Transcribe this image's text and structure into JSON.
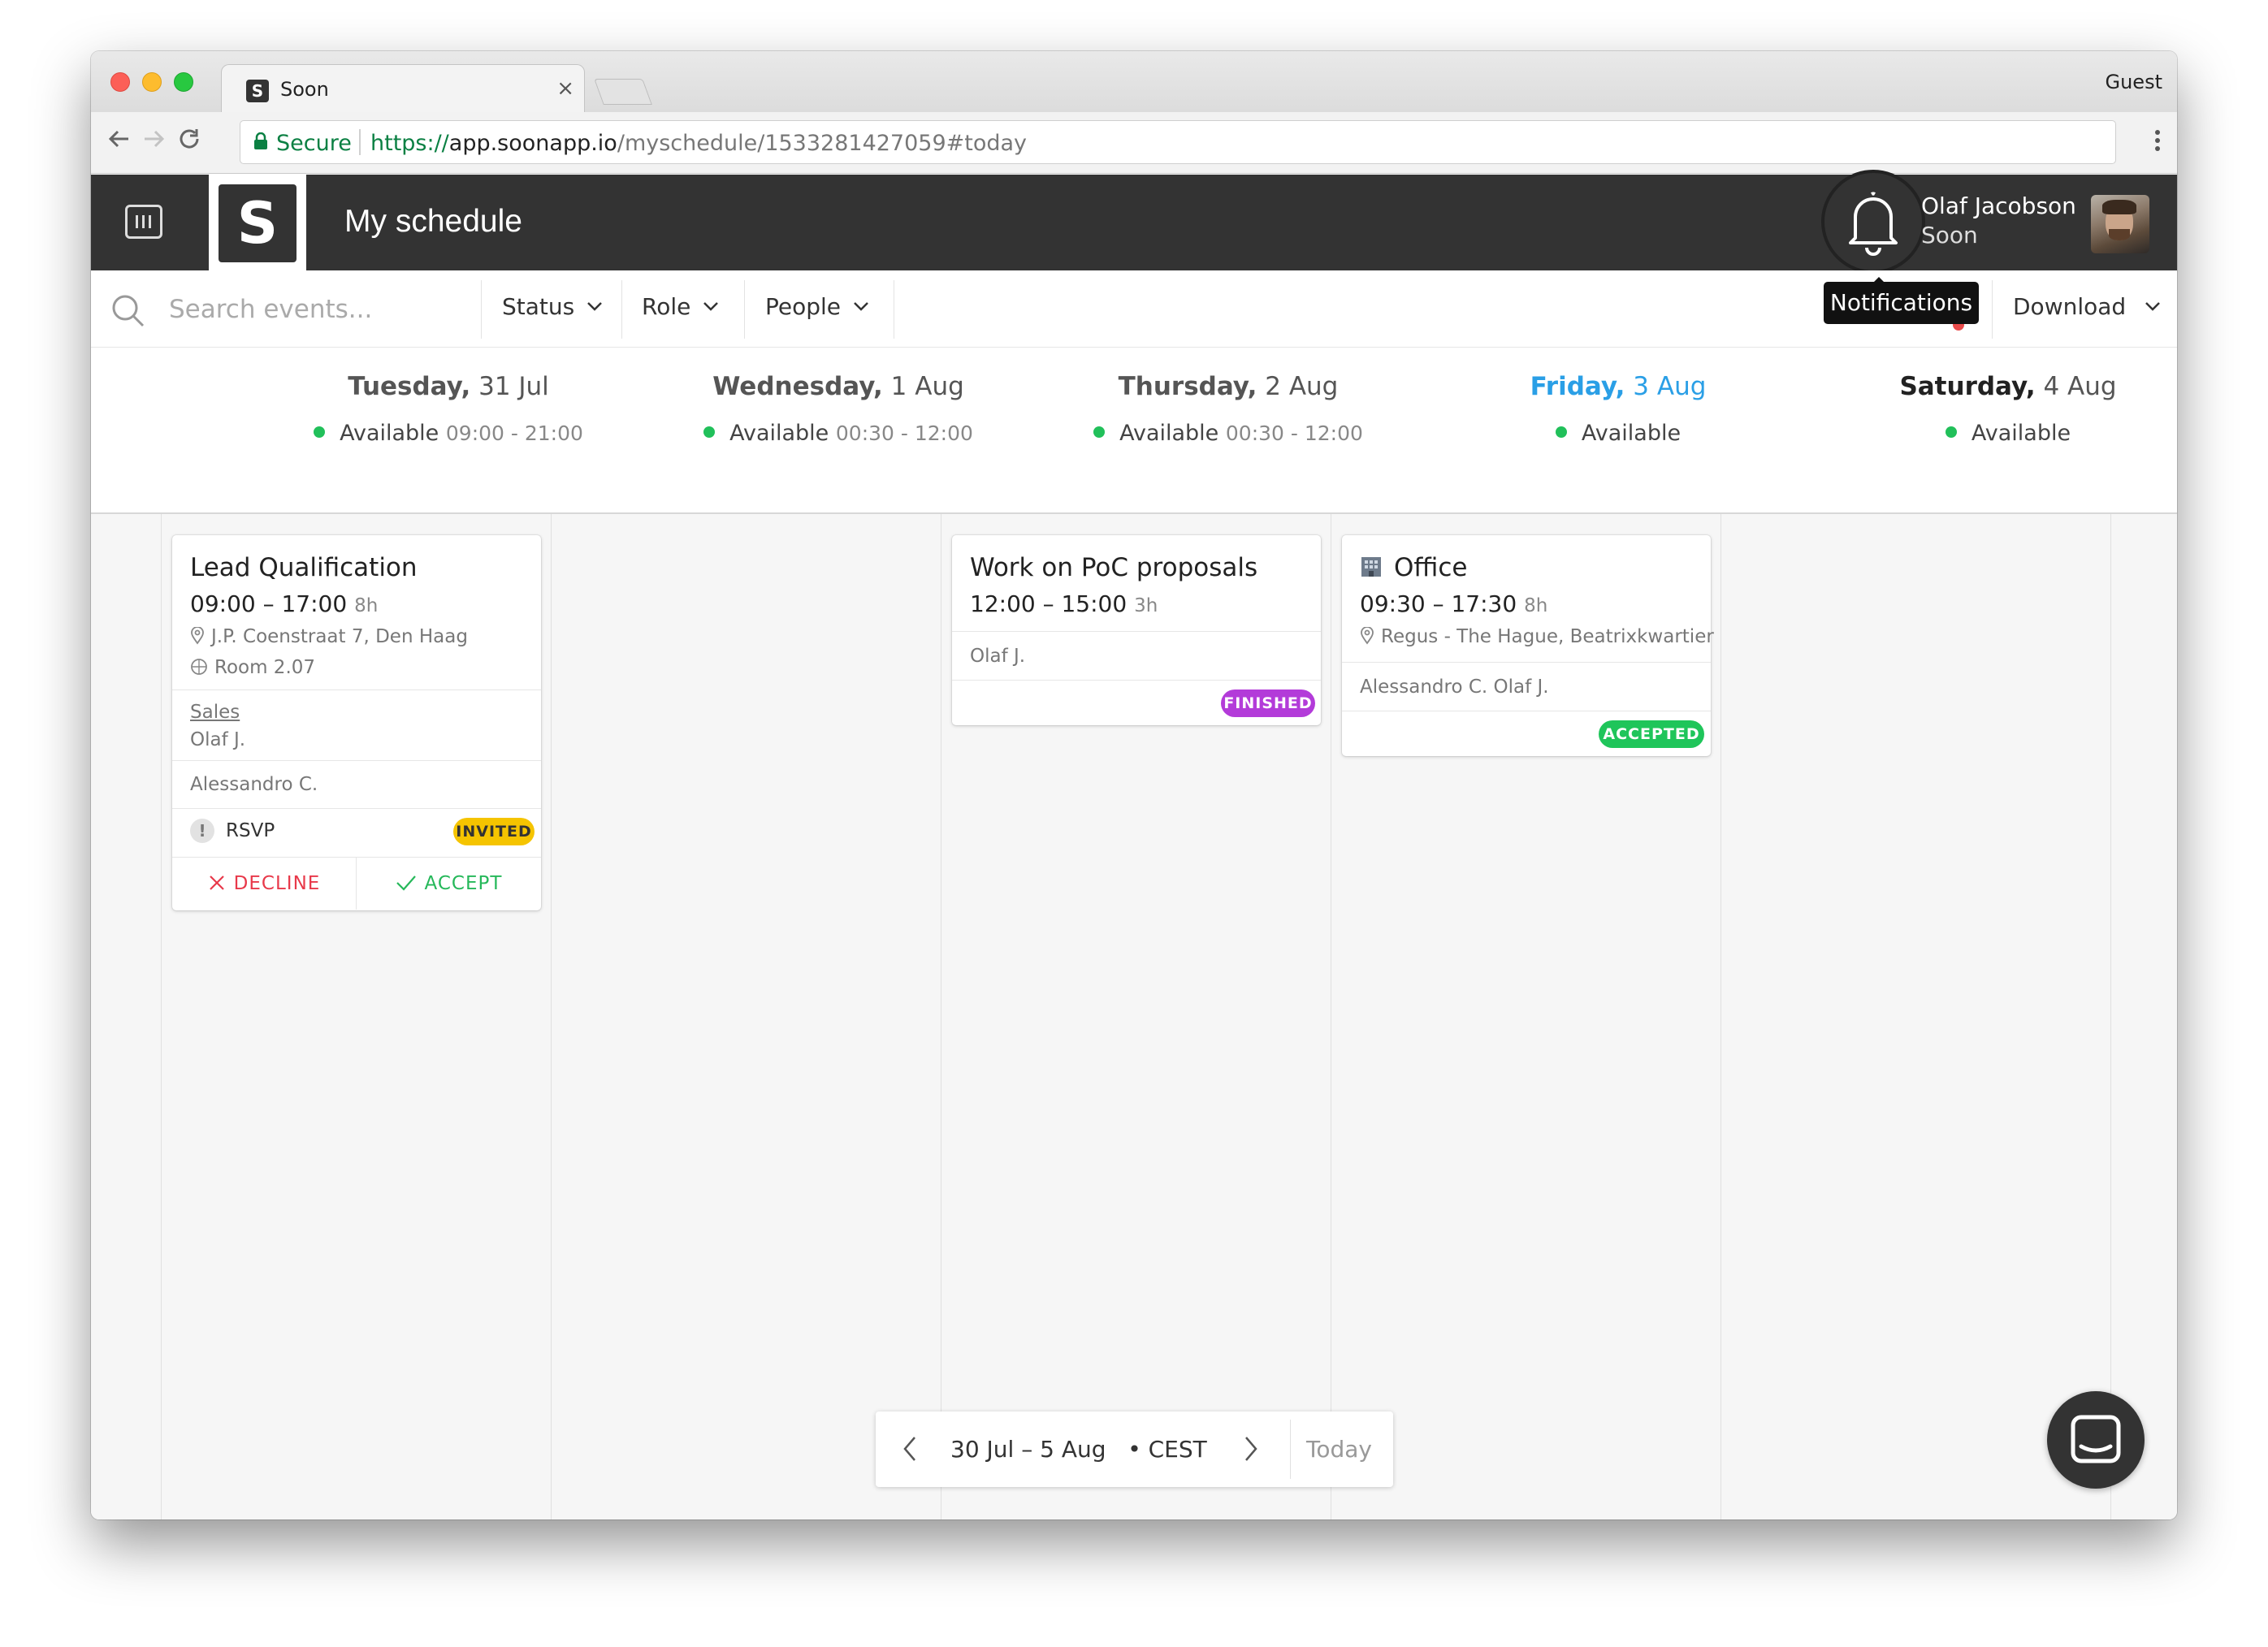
{
  "browser": {
    "tab_title": "Soon",
    "tab_favicon": "S",
    "tab_close": "×",
    "guest_label": "Guest",
    "secure_label": "Secure",
    "url_scheme": "https://",
    "url_host": "app.soonapp.io",
    "url_path": "/myschedule/1533281427059#today"
  },
  "header": {
    "logo": "S",
    "title": "My schedule",
    "user_name": "Olaf Jacobson",
    "user_org": "Soon",
    "notifications_tooltip": "Notifications"
  },
  "filters": {
    "search_placeholder": "Search events...",
    "status_label": "Status",
    "role_label": "Role",
    "people_label": "People",
    "download_label": "Download"
  },
  "days": [
    {
      "weekday": "Tuesday,",
      "date": "31 Jul",
      "availability": "Available",
      "hours": "09:00 - 21:00"
    },
    {
      "weekday": "Wednesday,",
      "date": "1 Aug",
      "availability": "Available",
      "hours": "00:30 - 12:00"
    },
    {
      "weekday": "Thursday,",
      "date": "2 Aug",
      "availability": "Available",
      "hours": "00:30 - 12:00"
    },
    {
      "weekday": "Friday,",
      "date": "3 Aug",
      "availability": "Available",
      "hours": ""
    },
    {
      "weekday": "Saturday,",
      "date": "4 Aug",
      "availability": "Available",
      "hours": ""
    }
  ],
  "events": {
    "lead": {
      "title": "Lead Qualification",
      "time": "09:00 – 17:00",
      "duration": "8h",
      "address": "J.P. Coenstraat 7, Den Haag",
      "room": "Room 2.07",
      "team": "Sales",
      "owner": "Olaf J.",
      "attendees": "Alessandro C.",
      "rsvp_icon": "!",
      "rsvp_label": "RSVP",
      "status": "INVITED",
      "decline_label": "DECLINE",
      "accept_label": "ACCEPT"
    },
    "poc": {
      "title": "Work on PoC proposals",
      "time": "12:00 – 15:00",
      "duration": "3h",
      "attendees": "Olaf J.",
      "status": "FINISHED"
    },
    "office": {
      "title": "Office",
      "time": "09:30 – 17:30",
      "duration": "8h",
      "address": "Regus - The Hague, Beatrixkwartier",
      "attendees": "Alessandro C. Olaf J.",
      "status": "ACCEPTED"
    }
  },
  "date_nav": {
    "range": "30 Jul – 5 Aug",
    "timezone": "• CEST",
    "today_label": "Today"
  },
  "colors": {
    "header_bg": "#333333",
    "today_blue": "#2a9fe6",
    "available_green": "#21c05a",
    "invited_yellow": "#f5c400",
    "finished_purple": "#b33bd9",
    "accepted_green": "#1fc55a",
    "decline_red": "#e8394a",
    "accept_green": "#26b85a"
  }
}
